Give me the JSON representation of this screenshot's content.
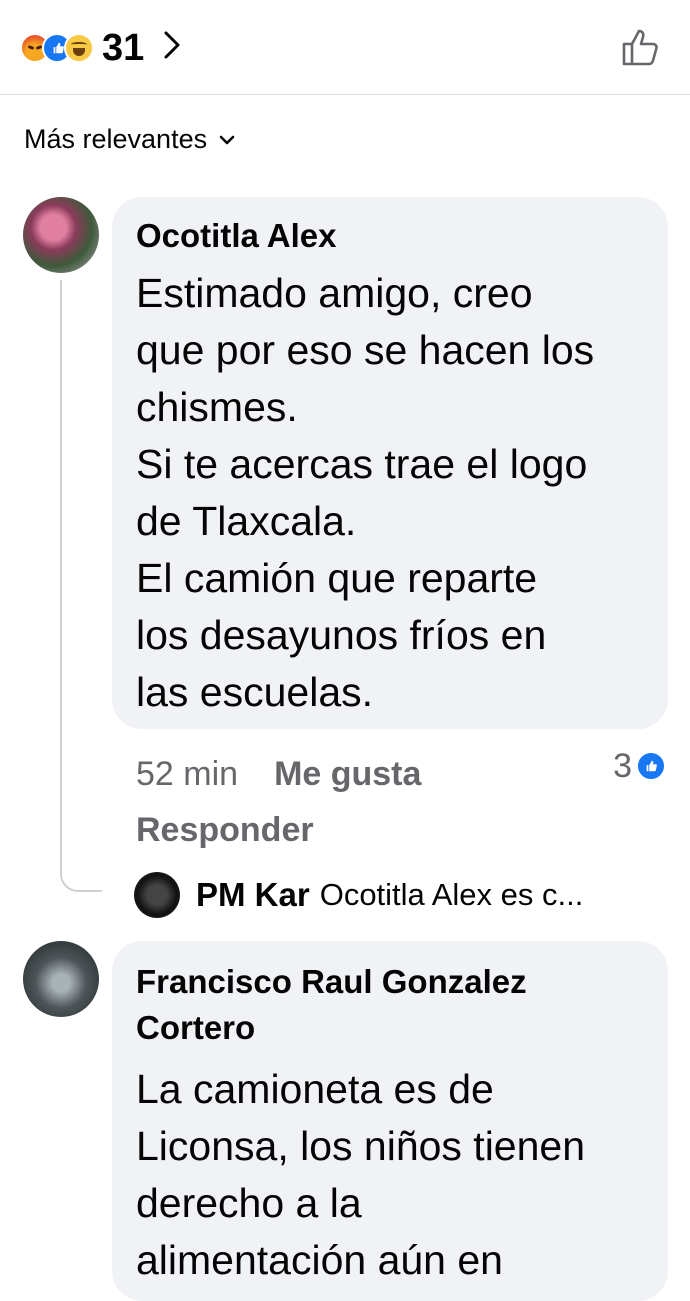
{
  "header": {
    "reactions": [
      "angry-reaction-icon",
      "like-reaction-icon",
      "haha-reaction-icon"
    ],
    "reaction_count": "31",
    "accent_color": "#1877f2"
  },
  "sort": {
    "label": "Más relevantes"
  },
  "comments": [
    {
      "author": "Ocotitla Alex",
      "text": "Estimado amigo, creo\nque por eso se hacen los\nchismes.\nSi te acercas trae el logo\nde Tlaxcala.\nEl camión que reparte\nlos desayunos fríos en\nlas escuelas.",
      "time": "52 min",
      "like_label": "Me gusta",
      "reply_label": "Responder",
      "like_count": "3",
      "reply_preview": {
        "author": "PM Kar",
        "snippet": "Ocotitla Alex es c..."
      }
    },
    {
      "author": "Francisco Raul Gonzalez\nCortero",
      "text": "La camioneta es de\nLiconsa, los niños tienen\nderecho a la\nalimentación aún en"
    }
  ]
}
